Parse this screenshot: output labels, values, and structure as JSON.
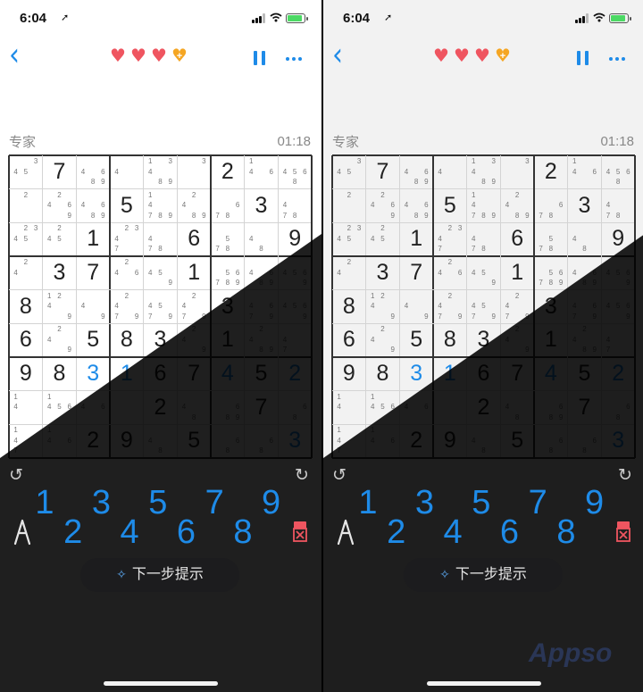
{
  "status_bar": {
    "time": "6:04",
    "location_glyph": "➚"
  },
  "nav": {
    "back_glyph": "‹",
    "hearts": 3,
    "bonus_heart_symbol": "+"
  },
  "game": {
    "level": "专家",
    "timer": "01:18"
  },
  "board": {
    "digits": [
      [
        0,
        7,
        0,
        0,
        0,
        0,
        2,
        0,
        0
      ],
      [
        0,
        0,
        0,
        5,
        0,
        0,
        0,
        3,
        0
      ],
      [
        0,
        0,
        1,
        0,
        0,
        6,
        0,
        0,
        9
      ],
      [
        0,
        3,
        7,
        0,
        0,
        1,
        0,
        0,
        0
      ],
      [
        8,
        0,
        0,
        0,
        0,
        0,
        3,
        0,
        0
      ],
      [
        6,
        0,
        5,
        8,
        3,
        0,
        1,
        0,
        0
      ],
      [
        9,
        8,
        3,
        1,
        6,
        7,
        4,
        5,
        2
      ],
      [
        0,
        0,
        0,
        0,
        2,
        0,
        0,
        7,
        0
      ],
      [
        0,
        0,
        2,
        9,
        0,
        5,
        0,
        0,
        3
      ]
    ],
    "blue_cells": [
      [
        6,
        2
      ],
      [
        6,
        3
      ],
      [
        6,
        6
      ],
      [
        6,
        8
      ],
      [
        8,
        8
      ]
    ],
    "notes": [
      [
        "345",
        "",
        "4689",
        "4",
        "13489",
        "3",
        "",
        "146",
        "4568"
      ],
      [
        "2",
        "2469",
        "4689",
        "",
        "14789",
        "2489",
        "678",
        "",
        "478"
      ],
      [
        "2345",
        "245",
        "",
        "2347",
        "478",
        "",
        "578",
        "48",
        ""
      ],
      [
        "24",
        "",
        "",
        "246",
        "459",
        "",
        "56789",
        "4689",
        "4569"
      ],
      [
        "",
        "1249",
        "49",
        "2479",
        "4579",
        "2479",
        "",
        "4679",
        "4569"
      ],
      [
        "",
        "249",
        "",
        "",
        "",
        "249",
        "",
        "2489",
        "47"
      ],
      [
        "",
        "",
        "",
        "",
        "",
        "",
        "",
        "",
        ""
      ],
      [
        "14",
        "1456",
        "46",
        "",
        "348",
        "48",
        "689",
        "",
        "68"
      ],
      [
        "147",
        "146",
        "",
        "",
        "48",
        "",
        "68",
        "68",
        ""
      ]
    ]
  },
  "controls": {
    "undo_glyph": "↺",
    "redo_glyph": "↻",
    "numbers": [
      "1",
      "2",
      "3",
      "4",
      "5",
      "6",
      "7",
      "8",
      "9"
    ],
    "hint_label": "下一步提示",
    "hint_icon_glyph": "✧"
  },
  "watermark": "Appso",
  "colors": {
    "accent": "#1e8be8",
    "heart": "#ef5560",
    "bonus_heart": "#f5a623",
    "dark_bg": "#1c1c1e"
  }
}
